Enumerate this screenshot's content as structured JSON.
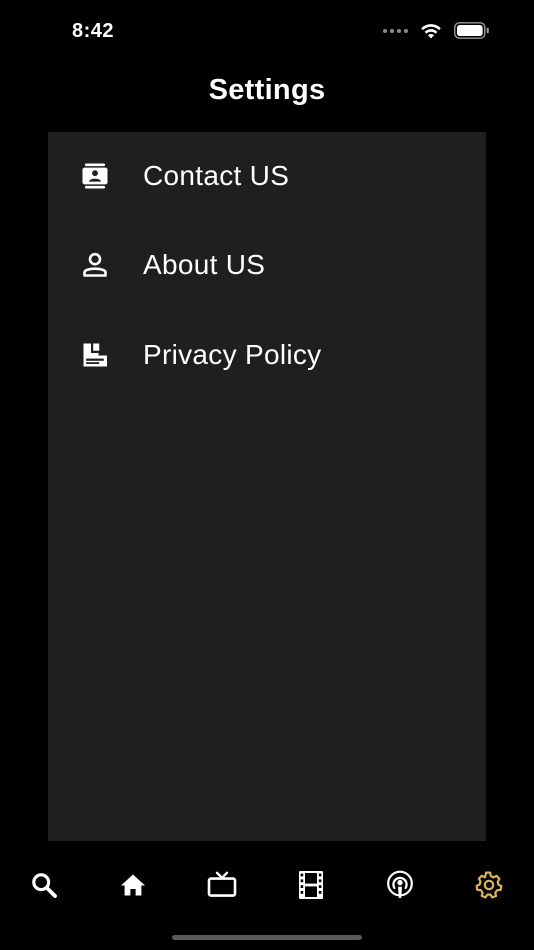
{
  "status_bar": {
    "time": "8:42",
    "icons": [
      "signal-dots-icon",
      "wifi-icon",
      "battery-icon"
    ]
  },
  "header": {
    "title": "Settings"
  },
  "settings_menu": {
    "items": [
      {
        "label": "Contact US",
        "icon": "contact-card-icon"
      },
      {
        "label": "About US",
        "icon": "person-icon"
      },
      {
        "label": "Privacy Policy",
        "icon": "policy-document-icon"
      }
    ]
  },
  "tab_bar": {
    "tabs": [
      {
        "icon": "search-icon",
        "selected": false
      },
      {
        "icon": "home-icon",
        "selected": false
      },
      {
        "icon": "tv-icon",
        "selected": false
      },
      {
        "icon": "film-icon",
        "selected": false
      },
      {
        "icon": "podcast-icon",
        "selected": false
      },
      {
        "icon": "gear-icon",
        "selected": true
      }
    ]
  },
  "colors": {
    "background": "#000000",
    "panel": "#1f1f1f",
    "text": "#ffffff",
    "accent_selected_tab": "#d9b35f",
    "home_indicator": "#5a5a5a"
  }
}
